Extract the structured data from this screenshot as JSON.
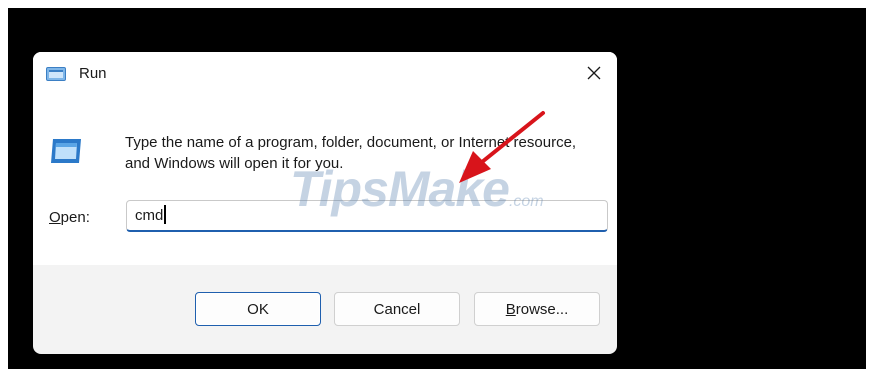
{
  "window": {
    "title": "Run",
    "close_glyph": "✕"
  },
  "description": "Type the name of a program, folder, document, or Internet resource, and Windows will open it for you.",
  "open_field": {
    "label_underlined": "O",
    "label_rest": "pen:",
    "value": "cmd"
  },
  "buttons": {
    "ok_label": "OK",
    "cancel_label": "Cancel",
    "browse_underlined": "B",
    "browse_rest": "rowse..."
  },
  "watermark": {
    "text": "TipsMake",
    "suffix": ".com"
  },
  "colors": {
    "accent": "#1f5fae",
    "annotation_arrow": "#d8141b"
  },
  "icons": [
    "run-app-icon",
    "close-icon",
    "run-large-icon",
    "annotation-arrow"
  ]
}
